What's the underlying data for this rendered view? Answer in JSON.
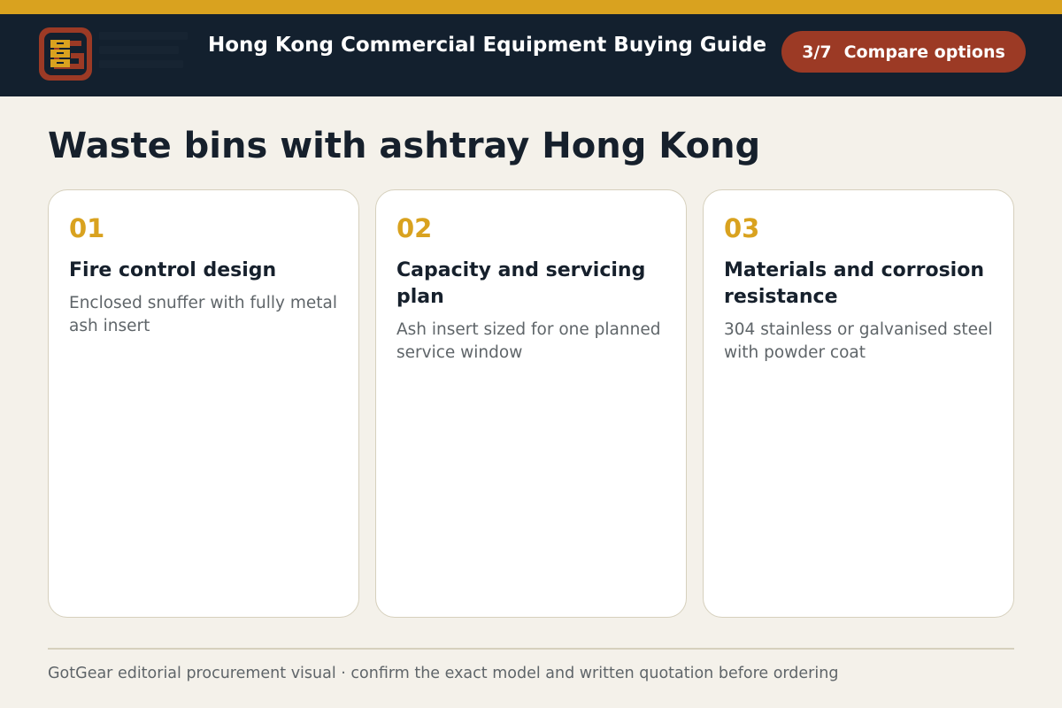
{
  "header": {
    "title": "Hong Kong Commercial Equipment Buying Guide",
    "step": {
      "count": "3/7",
      "label": "Compare options"
    },
    "logo_icon": "gotgear-logo-icon"
  },
  "page": {
    "title": "Waste bins with ashtray Hong Kong"
  },
  "cards": [
    {
      "number": "01",
      "heading": "Fire control design",
      "description": "Enclosed snuffer with fully metal ash insert"
    },
    {
      "number": "02",
      "heading": "Capacity and servicing plan",
      "description": "Ash insert sized for one planned service window"
    },
    {
      "number": "03",
      "heading": "Materials and corrosion resistance",
      "description": "304 stainless or galvanised steel with powder coat"
    }
  ],
  "footer": {
    "text": "GotGear editorial procurement visual · confirm the exact model and written quotation before ordering"
  },
  "colors": {
    "accent": "#d9a21f",
    "header_bg": "#13202e",
    "badge": "#9c3a25",
    "background": "#f4f1ea"
  }
}
